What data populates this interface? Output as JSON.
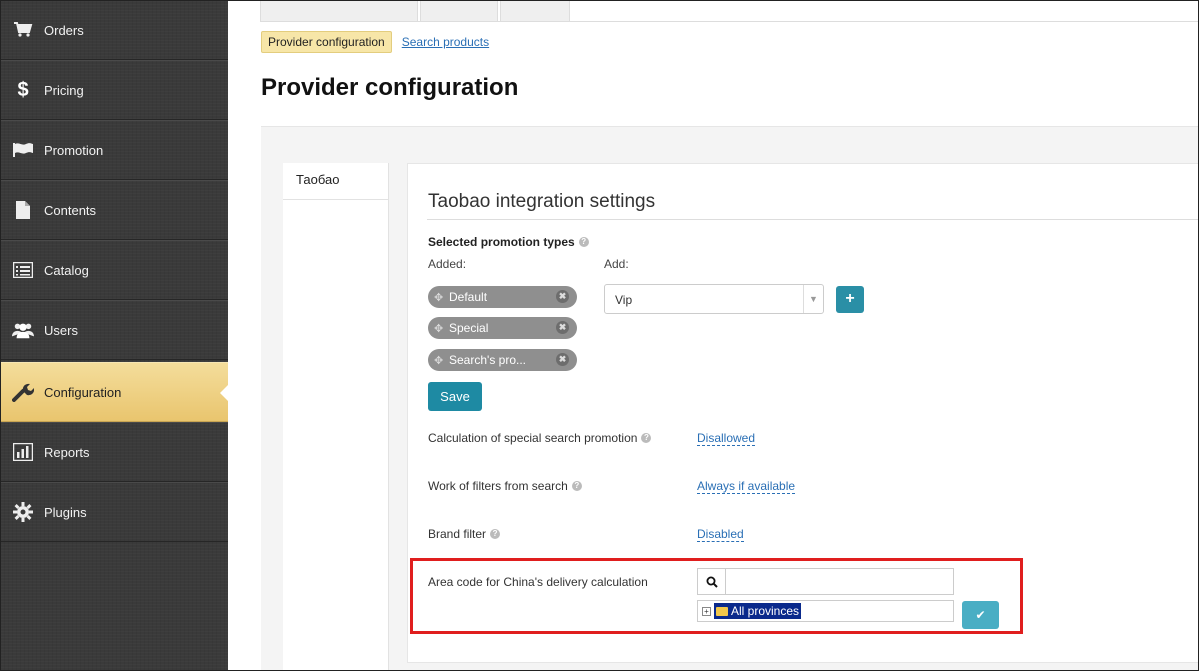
{
  "sidebar": {
    "items": [
      {
        "label": "Orders",
        "icon": "cart-icon"
      },
      {
        "label": "Pricing",
        "icon": "dollar-icon"
      },
      {
        "label": "Promotion",
        "icon": "flag-icon"
      },
      {
        "label": "Contents",
        "icon": "document-icon"
      },
      {
        "label": "Catalog",
        "icon": "list-icon"
      },
      {
        "label": "Users",
        "icon": "users-icon"
      },
      {
        "label": "Configuration",
        "icon": "wrench-icon",
        "active": true
      },
      {
        "label": "Reports",
        "icon": "bar-chart-icon"
      },
      {
        "label": "Plugins",
        "icon": "gear-icon"
      }
    ]
  },
  "breadcrumb": {
    "active": "Provider configuration",
    "link": "Search products"
  },
  "page_title": "Provider configuration",
  "provider_tabs": [
    "Таобао"
  ],
  "section": {
    "title": "Taobao integration settings",
    "promotion_types": {
      "label": "Selected promotion types",
      "added_label": "Added:",
      "add_label": "Add:",
      "added": [
        "Default",
        "Special",
        "Search's pro..."
      ],
      "select_value": "Vip",
      "plus_label": "+",
      "save_label": "Save"
    },
    "settings": [
      {
        "label": "Calculation of special search promotion",
        "value": "Disallowed"
      },
      {
        "label": "Work of filters from search",
        "value": "Always if available"
      },
      {
        "label": "Brand filter",
        "value": "Disabled"
      }
    ],
    "area_code": {
      "label": "Area code for China's delivery calculation",
      "search_value": "",
      "tree_root": "All provinces"
    }
  },
  "colors": {
    "sidebar_bg": "#3a3a3a",
    "active_nav": "#e9c56e",
    "primary_button": "#1e8aa3",
    "link": "#2a6fb5",
    "highlight_box": "#e01e1e"
  }
}
